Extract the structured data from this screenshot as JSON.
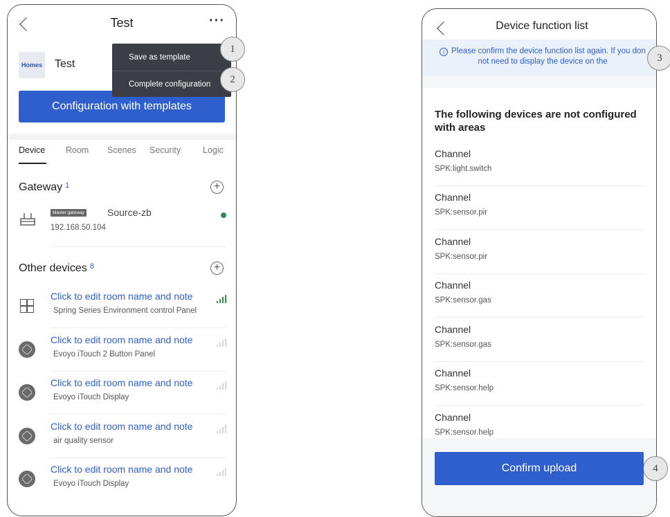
{
  "left": {
    "header": {
      "title": "Test",
      "more_label": "···"
    },
    "home": {
      "logo_text": "Homes",
      "name": "Test"
    },
    "config_button": "Configuration with templates",
    "menu": {
      "items": [
        "Save as template",
        "Complete configuration"
      ]
    },
    "tabs": [
      "Device",
      "Room",
      "Scenes",
      "Security",
      "Logic"
    ],
    "gateway": {
      "title": "Gateway",
      "count": "1",
      "add_label": "+",
      "badge": "Master gateway",
      "name": "Source-zb",
      "ip": "192.168.50.104",
      "status_color": "#2e8b57"
    },
    "other": {
      "title": "Other devices",
      "count": "8",
      "add_label": "+"
    },
    "devices": [
      {
        "title": "Click to edit room name and note",
        "subtitle": "Spring Series Environment control Panel",
        "icon": "panel-grid-icon",
        "signal": "strong"
      },
      {
        "title": "Click to edit room name and note",
        "subtitle": "Evoyo iTouch 2 Button Panel",
        "icon": "device-round-icon",
        "signal": "weak"
      },
      {
        "title": "Click to edit room name and note",
        "subtitle": "Evoyo iTouch Display",
        "icon": "device-round-icon",
        "signal": "weak"
      },
      {
        "title": "Click to edit room name and note",
        "subtitle": "air quality sensor",
        "icon": "device-round-icon",
        "signal": "weak"
      },
      {
        "title": "Click to edit room name and note",
        "subtitle": "Evoyo iTouch Display",
        "icon": "device-round-icon",
        "signal": "weak"
      }
    ]
  },
  "right": {
    "header": {
      "title": "Device function list"
    },
    "notice": {
      "icon": "info-icon",
      "text": "Please confirm the device function list again. If you don not need to display the device on the"
    },
    "heading": "The following devices are not configured with areas",
    "channels": [
      {
        "name": "Channel",
        "type": "SPK:light.switch"
      },
      {
        "name": "Channel",
        "type": "SPK:sensor.pir"
      },
      {
        "name": "Channel",
        "type": "SPK:sensor.pir"
      },
      {
        "name": "Channel",
        "type": "SPK:sensor.gas"
      },
      {
        "name": "Channel",
        "type": "SPK:sensor.gas"
      },
      {
        "name": "Channel",
        "type": "SPK:sensor.help"
      },
      {
        "name": "Channel",
        "type": "SPK:sensor.help"
      }
    ],
    "confirm_button": "Confirm upload"
  },
  "callouts": [
    "1",
    "2",
    "3",
    "4"
  ],
  "colors": {
    "primary": "#2f5fcc",
    "menu_bg": "#3b3e45",
    "notice_bg": "#eaf1fb",
    "signal_strong": "#2e9b3f",
    "signal_weak": "#d4d4d4"
  }
}
